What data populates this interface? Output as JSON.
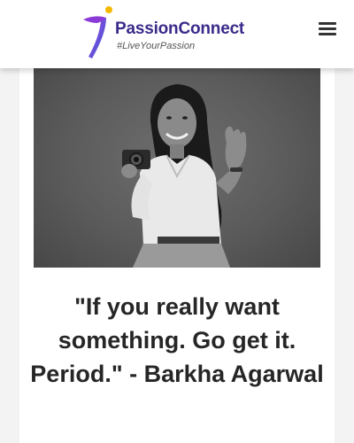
{
  "header": {
    "brand_name": "PassionConnect",
    "tagline": "#LiveYourPassion",
    "menu_icon": "hamburger-menu-icon"
  },
  "article": {
    "photo_icon": "woman-with-camera-photo",
    "quote": "\"If you really want something. Go get it. Period.\" - Barkha Agarwal"
  },
  "colors": {
    "brand_text": "#3b2a8a",
    "logo_yellow": "#f5b800",
    "logo_purple": "#6a2ad8",
    "logo_blue": "#2b5fd9",
    "quote_text": "#262626"
  }
}
